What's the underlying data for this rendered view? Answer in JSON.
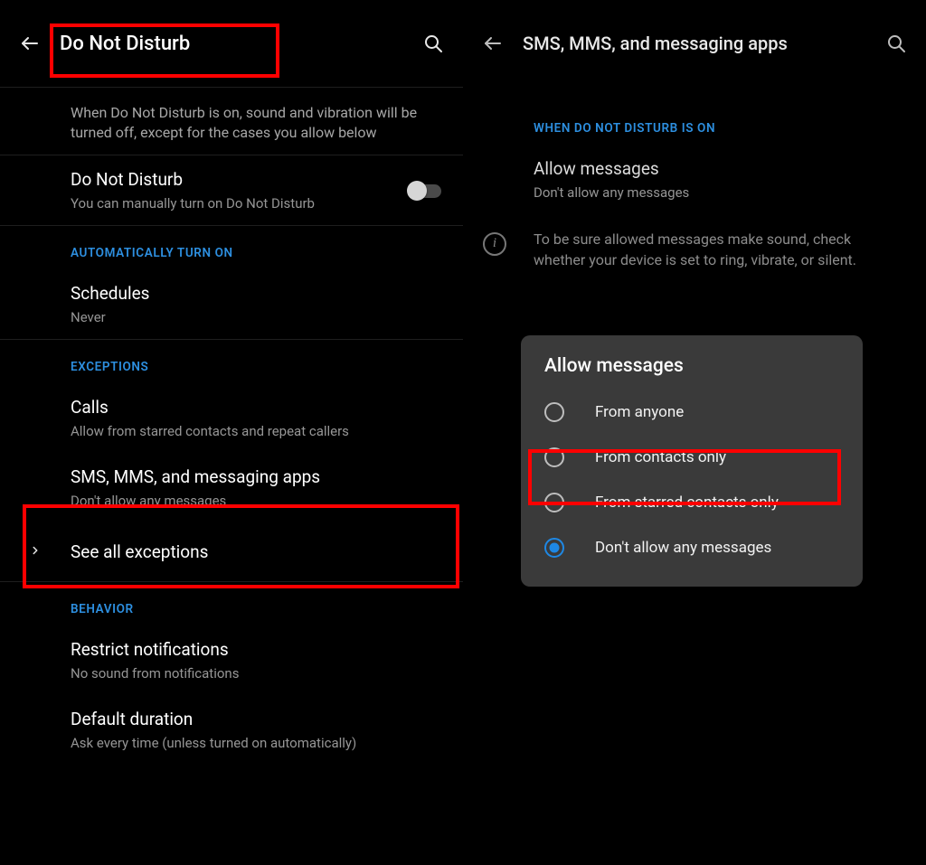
{
  "left": {
    "title": "Do Not Disturb",
    "description": "When Do Not Disturb is on, sound and vibration will be turned off, except for the cases you allow below",
    "toggle": {
      "label": "Do Not Disturb",
      "sub": "You can manually turn on Do Not Disturb",
      "on": false
    },
    "section_auto": "AUTOMATICALLY TURN ON",
    "schedules": {
      "label": "Schedules",
      "sub": "Never"
    },
    "section_exceptions": "EXCEPTIONS",
    "calls": {
      "label": "Calls",
      "sub": "Allow from starred contacts and repeat callers"
    },
    "sms": {
      "label": "SMS, MMS, and messaging apps",
      "sub": "Don't allow any messages"
    },
    "see_all": "See all exceptions",
    "section_behavior": "BEHAVIOR",
    "restrict": {
      "label": "Restrict notifications",
      "sub": "No sound from notifications"
    },
    "default_duration": {
      "label": "Default duration",
      "sub": "Ask every time (unless turned on automatically)"
    }
  },
  "right": {
    "title": "SMS, MMS, and messaging apps",
    "section": "WHEN DO NOT DISTURB IS ON",
    "allow_messages": {
      "label": "Allow messages",
      "sub": "Don't allow any messages"
    },
    "info": "To be sure allowed messages make sound, check whether your device is set to ring, vibrate, or silent."
  },
  "dialog": {
    "title": "Allow messages",
    "options": [
      "From anyone",
      "From contacts only",
      "From starred contacts only",
      "Don't allow any messages"
    ],
    "selected_index": 3
  }
}
